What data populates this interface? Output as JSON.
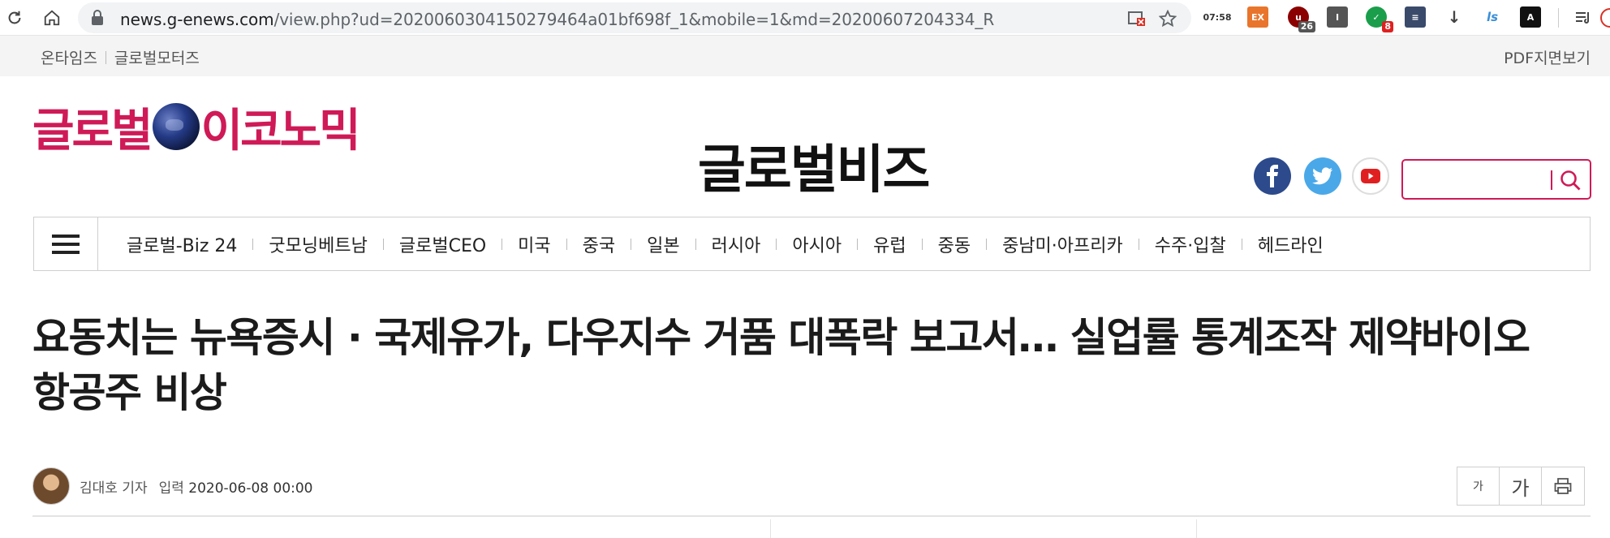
{
  "browser": {
    "url_host": "news.g-enews.com",
    "url_path": "/view.php?ud=2020060304150279464a01bf698f_1&mobile=1&md=20200607204334_R",
    "extensions": [
      {
        "name": "clock-ext",
        "label": "07:58"
      },
      {
        "name": "ex-ext",
        "label": "EX"
      },
      {
        "name": "ublock-ext",
        "label": "u",
        "badge": "26"
      },
      {
        "name": "i-ext",
        "label": "I"
      },
      {
        "name": "shield-ext",
        "label": "✓",
        "badge": "8"
      },
      {
        "name": "stack-ext",
        "label": "≡"
      },
      {
        "name": "download-ext",
        "label": "↓"
      },
      {
        "name": "ls-ext",
        "label": "ls"
      },
      {
        "name": "astar-ext",
        "label": "A"
      }
    ]
  },
  "utilbar": {
    "links": [
      "온타임즈",
      "글로벌모터즈"
    ],
    "pdf": "PDF지면보기"
  },
  "header": {
    "logo_left": "글로벌",
    "logo_right": "이코노믹",
    "section_title": "글로벌비즈",
    "search_placeholder": ""
  },
  "nav": {
    "items": [
      "글로벌-Biz 24",
      "굿모닝베트남",
      "글로벌CEO",
      "미국",
      "중국",
      "일본",
      "러시아",
      "아시아",
      "유럽",
      "중동",
      "중남미·아프리카",
      "수주·입찰",
      "헤드라인"
    ]
  },
  "article": {
    "headline_line1": "요동치는 뉴욕증시 · 국제유가, 다우지수 거품 대폭락 보고서… 실업률 통계조작 제약바이오",
    "headline_line2": "항공주 비상",
    "author": "김대호 기자",
    "date_label": "입력",
    "date": "2020-06-08 00:00",
    "font_small": "가",
    "font_large": "가"
  },
  "colors": {
    "brand": "#cf1a57",
    "facebook": "#2c4a8c",
    "twitter": "#4aa8e8",
    "youtube": "#e02020"
  }
}
